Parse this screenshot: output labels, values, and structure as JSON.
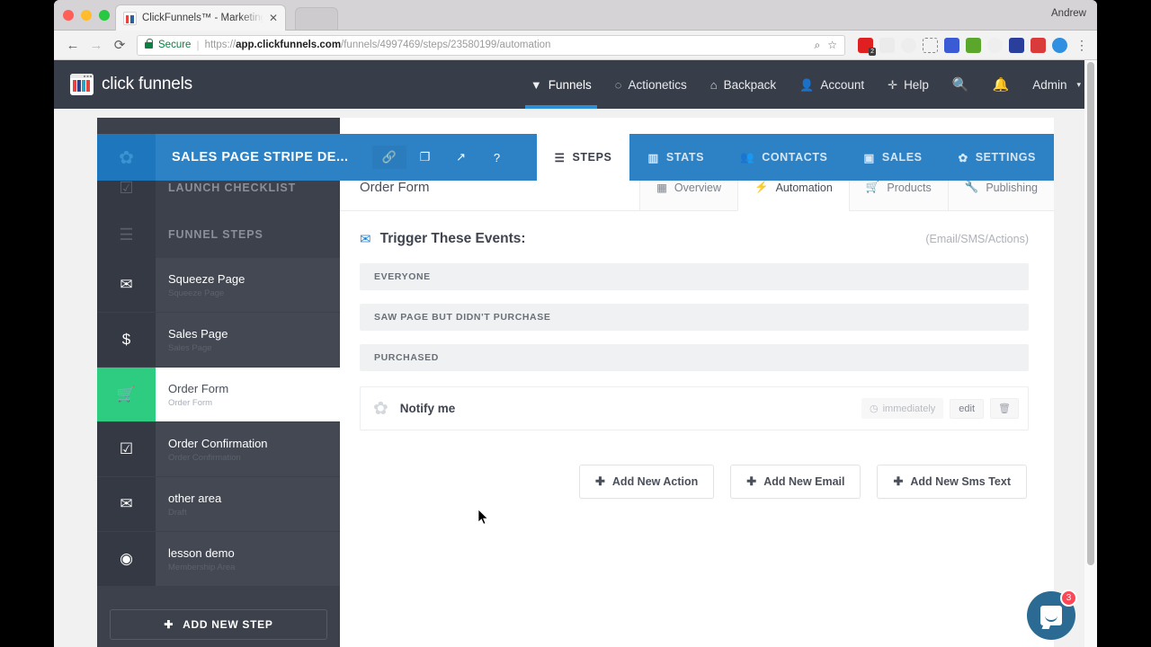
{
  "browser": {
    "tab_title": "ClickFunnels™ - Marketing Fu",
    "tab_close": "✕",
    "window_user": "Andrew",
    "back": "←",
    "forward": "→",
    "reload": "⟳",
    "secure_label": "Secure",
    "url_separator": "|",
    "url_scheme": "https://",
    "url_host": "app.clickfunnels.com",
    "url_path": "/funnels/4997469/steps/23580199/automation",
    "zoom_icon": "⌕",
    "bookmark_icon": "☆",
    "menu_icon": "⋮",
    "extension_badge": "2"
  },
  "topnav": {
    "brand": "click funnels",
    "items": [
      {
        "label": "Funnels",
        "icon": "▼",
        "active": true
      },
      {
        "label": "Actionetics",
        "icon": "◌",
        "active": false
      },
      {
        "label": "Backpack",
        "icon": "⌂",
        "active": false
      },
      {
        "label": "Account",
        "icon": "👤",
        "active": false
      },
      {
        "label": "Help",
        "icon": "✛",
        "active": false
      }
    ],
    "search_icon": "🔍",
    "bell_icon": "🔔",
    "user_label": "Admin",
    "user_caret": "▾"
  },
  "funnel_header": {
    "gear_icon": "✿",
    "title": "SALES PAGE STRIPE DE...",
    "tools": [
      {
        "name": "link-icon",
        "glyph": "🔗"
      },
      {
        "name": "copy-icon",
        "glyph": "❐"
      },
      {
        "name": "external-link-icon",
        "glyph": "↗"
      },
      {
        "name": "help-icon",
        "glyph": "?"
      }
    ],
    "tabs": [
      {
        "label": "STEPS",
        "icon": "☰",
        "active": true
      },
      {
        "label": "STATS",
        "icon": "▥",
        "active": false
      },
      {
        "label": "CONTACTS",
        "icon": "👥",
        "active": false
      },
      {
        "label": "SALES",
        "icon": "▣",
        "active": false
      },
      {
        "label": "SETTINGS",
        "icon": "✿",
        "active": false
      }
    ]
  },
  "sidebar": {
    "headers": [
      {
        "label": "LAUNCH CHECKLIST",
        "icon": "☑"
      },
      {
        "label": "FUNNEL STEPS",
        "icon": "☰"
      }
    ],
    "steps": [
      {
        "label": "Squeeze Page",
        "sub": "Squeeze Page",
        "icon": "✉",
        "selected": false
      },
      {
        "label": "Sales Page",
        "sub": "Sales Page",
        "icon": "$",
        "selected": false
      },
      {
        "label": "Order Form",
        "sub": "Order Form",
        "icon": "🛒",
        "selected": true
      },
      {
        "label": "Order Confirmation",
        "sub": "Order Confirmation",
        "icon": "☑",
        "selected": false
      },
      {
        "label": "other area",
        "sub": "Draft",
        "icon": "✉",
        "selected": false
      },
      {
        "label": "lesson demo",
        "sub": "Membership Area",
        "icon": "◉",
        "selected": false
      }
    ],
    "add_step_label": "ADD NEW STEP",
    "add_step_plus": "✚"
  },
  "main": {
    "page_title": "Order Form",
    "tabs": [
      {
        "label": "Overview",
        "icon": "▦",
        "active": false
      },
      {
        "label": "Automation",
        "icon": "⚡",
        "active": true
      },
      {
        "label": "Products",
        "icon": "🛒",
        "active": false
      },
      {
        "label": "Publishing",
        "icon": "🔧",
        "active": false
      }
    ],
    "trigger_icon": "✉",
    "trigger_title": "Trigger These Events:",
    "trigger_note": "(Email/SMS/Actions)",
    "events": [
      {
        "label": "EVERYONE"
      },
      {
        "label": "SAW PAGE BUT DIDN'T PURCHASE"
      },
      {
        "label": "PURCHASED"
      }
    ],
    "actions": [
      {
        "name": "Notify me",
        "gear_icon": "✿",
        "timing_icon": "◷",
        "timing": "immediately",
        "edit_label": "edit",
        "delete_icon": "🗑"
      }
    ],
    "add_buttons": [
      {
        "label": "Add New Action",
        "plus": "✚"
      },
      {
        "label": "Add New Email",
        "plus": "✚"
      },
      {
        "label": "Add New Sms Text",
        "plus": "✚"
      }
    ]
  },
  "intercom": {
    "badge": "3"
  },
  "colors": {
    "topnav_bg": "#373d49",
    "funnel_blue": "#2d82c6",
    "selected_green": "#2ecc80",
    "sidebar_bg": "#3c414c",
    "badge_red": "#ff4757"
  }
}
